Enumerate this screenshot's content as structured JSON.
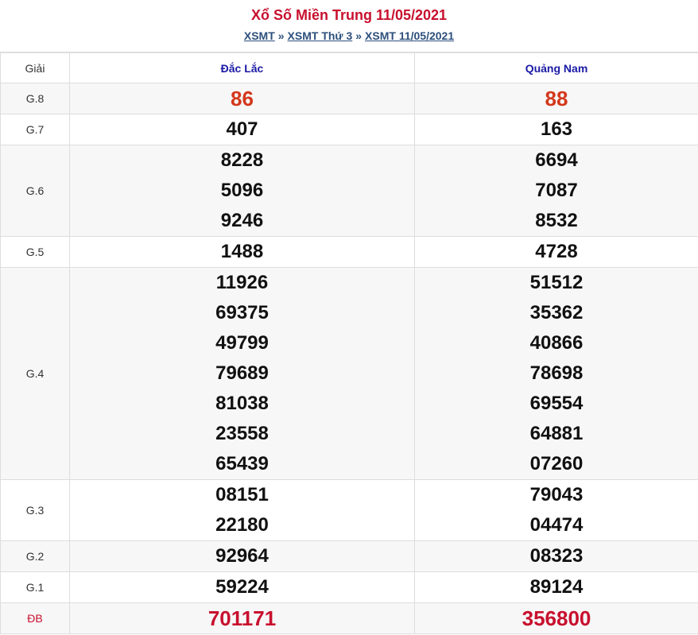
{
  "header": {
    "title": "Xổ Số Miền Trung 11/05/2021",
    "breadcrumb": [
      "XSMT",
      "XSMT Thứ 3",
      "XSMT 11/05/2021"
    ],
    "separator": "»"
  },
  "table": {
    "col_label": "Giải",
    "provinces": [
      "Đắc Lắc",
      "Quảng Nam"
    ],
    "rows": [
      {
        "label": "G.8",
        "a": [
          "86"
        ],
        "b": [
          "88"
        ],
        "style": "red"
      },
      {
        "label": "G.7",
        "a": [
          "407"
        ],
        "b": [
          "163"
        ],
        "style": ""
      },
      {
        "label": "G.6",
        "a": [
          "8228",
          "5096",
          "9246"
        ],
        "b": [
          "6694",
          "7087",
          "8532"
        ],
        "style": ""
      },
      {
        "label": "G.5",
        "a": [
          "1488"
        ],
        "b": [
          "4728"
        ],
        "style": ""
      },
      {
        "label": "G.4",
        "a": [
          "11926",
          "69375",
          "49799",
          "79689",
          "81038",
          "23558",
          "65439"
        ],
        "b": [
          "51512",
          "35362",
          "40866",
          "78698",
          "69554",
          "64881",
          "07260"
        ],
        "style": ""
      },
      {
        "label": "G.3",
        "a": [
          "08151",
          "22180"
        ],
        "b": [
          "79043",
          "04474"
        ],
        "style": ""
      },
      {
        "label": "G.2",
        "a": [
          "92964"
        ],
        "b": [
          "08323"
        ],
        "style": ""
      },
      {
        "label": "G.1",
        "a": [
          "59224"
        ],
        "b": [
          "89124"
        ],
        "style": ""
      },
      {
        "label": "ĐB",
        "a": [
          "701171"
        ],
        "b": [
          "356800"
        ],
        "style": "dbred"
      }
    ]
  },
  "colors": {
    "title": "#c8102e",
    "link": "#2d4f7c",
    "province": "#1a1aa6",
    "g8": "#d4371c",
    "db": "#c8102e",
    "alt_row": "#f7f7f7"
  }
}
